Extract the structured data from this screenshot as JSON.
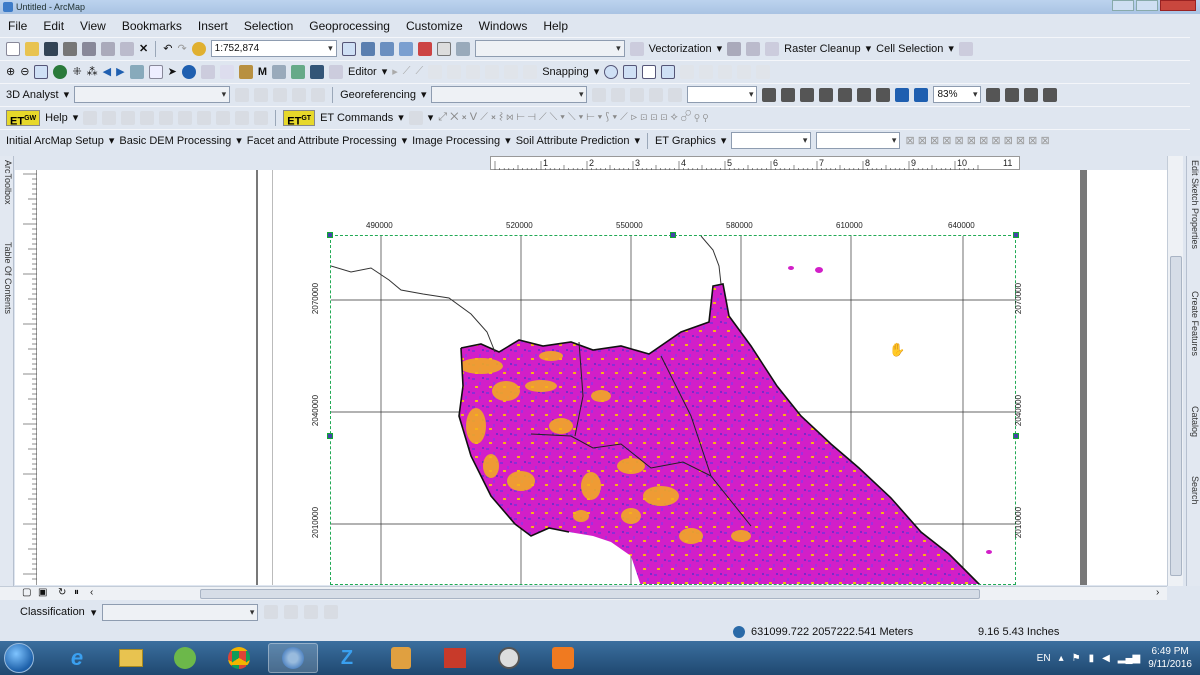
{
  "window": {
    "title": "Untitled - ArcMap"
  },
  "menu": [
    "File",
    "Edit",
    "View",
    "Bookmarks",
    "Insert",
    "Selection",
    "Geoprocessing",
    "Customize",
    "Windows",
    "Help"
  ],
  "toolbar1": {
    "scale": "1:752,874",
    "vectorization": "Vectorization",
    "raster_cleanup": "Raster Cleanup",
    "cell_selection": "Cell Selection"
  },
  "toolbar2": {
    "editor": "Editor",
    "snapping": "Snapping"
  },
  "toolbar3": {
    "analyst": "3D Analyst",
    "georef": "Georeferencing",
    "zoom": "83%"
  },
  "toolbar4": {
    "et_gw": "GW",
    "help": "Help",
    "et_gt": "GT",
    "et_commands": "ET Commands"
  },
  "toolbar5": {
    "items": [
      "Initial ArcMap Setup",
      "Basic DEM Processing",
      "Facet and Attribute Processing",
      "Image Processing",
      "Soil Attribute Prediction"
    ],
    "et_graphics": "ET Graphics"
  },
  "docks": {
    "left": [
      "ArcToolbox",
      "Table Of Contents"
    ],
    "right": [
      "Edit Sketch Properties",
      "Create Features",
      "Catalog",
      "Search"
    ]
  },
  "ruler": [
    "1",
    "2",
    "3",
    "4",
    "5",
    "6",
    "7",
    "8",
    "9",
    "10",
    "11"
  ],
  "map": {
    "x_ticks": [
      "490000",
      "520000",
      "550000",
      "580000",
      "610000",
      "640000"
    ],
    "y_ticks": [
      "2070000",
      "2040000",
      "2010000"
    ],
    "colors": {
      "magenta": "#d21fc8",
      "purple": "#8a2fd6",
      "orange": "#f5b21a",
      "boundary": "#1a1a1a"
    }
  },
  "bottom": {
    "classification": "Classification"
  },
  "status": {
    "coords": "631099.722  2057222.541 Meters",
    "page": "9.16  5.43 Inches"
  },
  "taskbar": {
    "lang": "EN",
    "time": "6:49 PM",
    "date": "9/11/2016"
  },
  "icons": [
    "start-orb",
    "ie-icon",
    "explorer-icon",
    "chrome-icon",
    "arcmap-icon"
  ]
}
